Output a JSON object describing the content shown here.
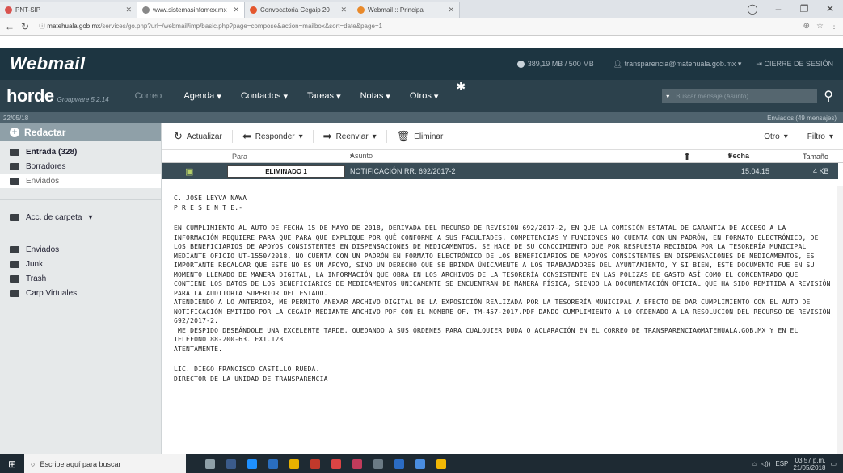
{
  "browser": {
    "tabs": [
      {
        "label": "PNT-SIP",
        "color": "#d9534f"
      },
      {
        "label": "www.sistemasinfomex.mx",
        "color": "#888888"
      },
      {
        "label": "Convocatoria Cegaip 20",
        "color": "#e4572e"
      },
      {
        "label": "Webmail :: Principal",
        "color": "#e98a2b"
      }
    ],
    "url_host": "matehuala.gob.mx",
    "url_path": "/services/go.php?url=/webmail/imp/basic.php?page=compose&action=mailbox&sort=date&page=1"
  },
  "webmail": {
    "logo": "Webmail",
    "quota": "389,19 MB / 500 MB",
    "user": "transparencia@matehuala.gob.mx",
    "logout": "CIERRE DE SESIÓN"
  },
  "horde": {
    "brand": "horde",
    "version": "Groupware 5.2.14",
    "menu": [
      "Correo",
      "Agenda",
      "Contactos",
      "Tareas",
      "Notas",
      "Otros"
    ],
    "search_placeholder": "Buscar mensaje (Asunto)"
  },
  "strip": {
    "date": "22/05/18",
    "folder_info": "Enviados (49 mensajes)"
  },
  "sidebar": {
    "compose": "Redactar",
    "folders": [
      "Entrada (328)",
      "Borradores",
      "Enviados"
    ],
    "folder_actions": "Acc. de carpeta",
    "extra_folders": [
      "Enviados",
      "Junk",
      "Trash",
      "Carp Virtuales"
    ]
  },
  "toolbar": {
    "refresh": "Actualizar",
    "reply": "Responder",
    "forward": "Reenviar",
    "delete": "Eliminar",
    "other": "Otro",
    "filter": "Filtro"
  },
  "list": {
    "columns": {
      "to": "Para",
      "subject": "Asunto",
      "date": "Fecha",
      "size": "Tamaño"
    },
    "row": {
      "to": "ELIMINADO 1",
      "subject": "NOTIFICACIÓN RR. 692/2017-2",
      "date": "15:04:15",
      "size": "4 KB"
    }
  },
  "message": {
    "salutation": "C. JOSE LEYVA NAWA\nP R E S E N T E.-",
    "paragraph1": "EN CUMPLIMIENTO AL AUTO DE FECHA 15 DE MAYO DE 2018, DERIVADA DEL RECURSO DE REVISIÓN 692/2017-2, EN QUE LA COMISIÓN ESTATAL DE GARANTÍA DE ACCESO A LA INFORMACIÓN REQUIERE PARA QUE PARA QUE EXPLIQUE POR QUÉ CONFORME A SUS FACULTADES, COMPETENCIAS Y FUNCIONES NO CUENTA CON UN PADRÓN, EN FORMATO ELECTRÓNICO, DE LOS BENEFICIARIOS DE APOYOS CONSISTENTES EN DISPENSACIONES DE MEDICAMENTOS, SE HACE DE SU CONOCIMIENTO QUE POR RESPUESTA RECIBIDA POR LA TESORERÍA MUNICIPAL MEDIANTE OFICIO UT-1550/2018, NO CUENTA CON UN PADRÓN EN FORMATO ELECTRÓNICO DE LOS BENEFICIARIOS DE APOYOS CONSISTENTES EN DISPENSACIONES DE MEDICAMENTOS, ES IMPORTANTE RECALCAR QUE ESTE NO ES UN APOYO, SINO UN DERECHO QUE SE BRINDA ÚNICAMENTE A LOS TRABAJADORES DEL AYUNTAMIENTO, Y SI BIEN, ESTE DOCUMENTO FUE EN SU MOMENTO LLENADO DE MANERA DIGITAL, LA INFORMACIÓN QUE OBRA EN LOS ARCHIVOS DE LA TESORERÍA CONSISTENTE EN LAS PÓLIZAS DE GASTO ASÍ COMO EL CONCENTRADO QUE CONTIENE LOS DATOS DE LOS BENEFICIARIOS DE MEDICAMENTOS ÚNICAMENTE SE ENCUENTRAN DE MANERA FÍSICA, SIENDO LA DOCUMENTACIÓN OFICIAL QUE HA SIDO REMITIDA A REVISIÓN PARA LA AUDITORIA SUPERIOR DEL ESTADO.",
    "paragraph2": "ATENDIENDO A LO ANTERIOR, ME PERMITO ANEXAR ARCHIVO DIGITAL DE LA EXPOSICIÓN REALIZADA POR LA TESORERÍA MUNICIPAL A EFECTO DE DAR CUMPLIMIENTO CON EL AUTO DE NOTIFICACIÓN EMITIDO POR LA CEGAIP MEDIANTE ARCHIVO PDF CON EL NOMBRE OF. TM-457-2017.PDF DANDO CUMPLIMIENTO A LO ORDENADO A LA RESOLUCIÓN DEL RECURSO DE REVISIÓN 692/2017-2.",
    "paragraph3": " ME DESPIDO DESEÁNDOLE UNA EXCELENTE TARDE, QUEDANDO A SUS ÓRDENES PARA CUALQUIER DUDA O ACLARACIÓN EN EL CORREO DE TRANSPARENCIA@MATEHUALA.GOB.MX Y EN EL TELÉFONO 88-200-63. EXT.128\nATENTAMENTE.",
    "signature": "LIC. DIEGO FRANCISCO CASTILLO RUEDA.\nDIRECTOR DE LA UNIDAD DE TRANSPARENCIA"
  },
  "taskbar": {
    "search": "Escribe aquí para buscar",
    "lang": "ESP",
    "time": "03:57 p.m.",
    "date": "21/05/2018"
  }
}
